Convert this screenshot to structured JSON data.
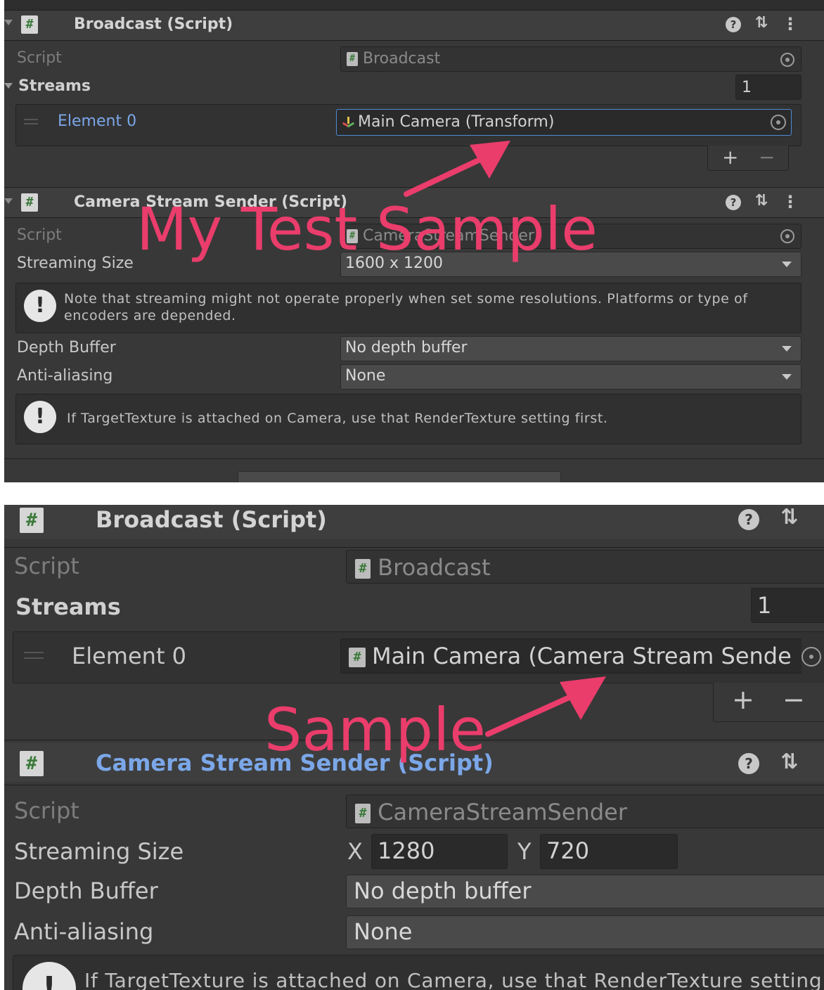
{
  "top": {
    "broadcast": {
      "title": "Broadcast (Script)",
      "script_label": "Script",
      "script_value": "Broadcast",
      "streams_label": "Streams",
      "streams_count": "1",
      "element_label": "Element 0",
      "element_value": "Main Camera (Transform)",
      "add": "+",
      "remove": "−"
    },
    "sender": {
      "title": "Camera Stream Sender (Script)",
      "script_label": "Script",
      "script_value": "CameraStreamSender",
      "size_label": "Streaming Size",
      "size_value": "1600 x 1200",
      "note": "Note that streaming might not operate properly when set some resolutions. Platforms or type of encoders are depended.",
      "depth_label": "Depth Buffer",
      "depth_value": "No depth buffer",
      "aa_label": "Anti-aliasing",
      "aa_value": "None",
      "warning": "If TargetTexture is attached on Camera, use that RenderTexture setting first."
    },
    "annotation": "My Test Sample"
  },
  "bottom": {
    "broadcast": {
      "title": "Broadcast (Script)",
      "script_label": "Script",
      "script_value": "Broadcast",
      "streams_label": "Streams",
      "streams_count": "1",
      "element_label": "Element 0",
      "element_value": "Main Camera (Camera Stream Sende",
      "add": "+",
      "remove": "−"
    },
    "sender": {
      "title": "Camera Stream Sender (Script)",
      "script_label": "Script",
      "script_value": "CameraStreamSender",
      "size_label": "Streaming Size",
      "x_label": "X",
      "x_value": "1280",
      "y_label": "Y",
      "y_value": "720",
      "depth_label": "Depth Buffer",
      "depth_value": "No depth buffer",
      "aa_label": "Anti-aliasing",
      "aa_value": "None",
      "warning": "If TargetTexture is attached on Camera, use that RenderTexture setting"
    },
    "annotation": "Sample"
  },
  "icons": {
    "help": "?",
    "settings": "⇅",
    "menu": "⋮",
    "hash": "#",
    "warning": "!"
  },
  "colors": {
    "panel": "#383838",
    "accent_blue": "#7ba7e8",
    "annotation_pink": "#ea3d6c"
  }
}
